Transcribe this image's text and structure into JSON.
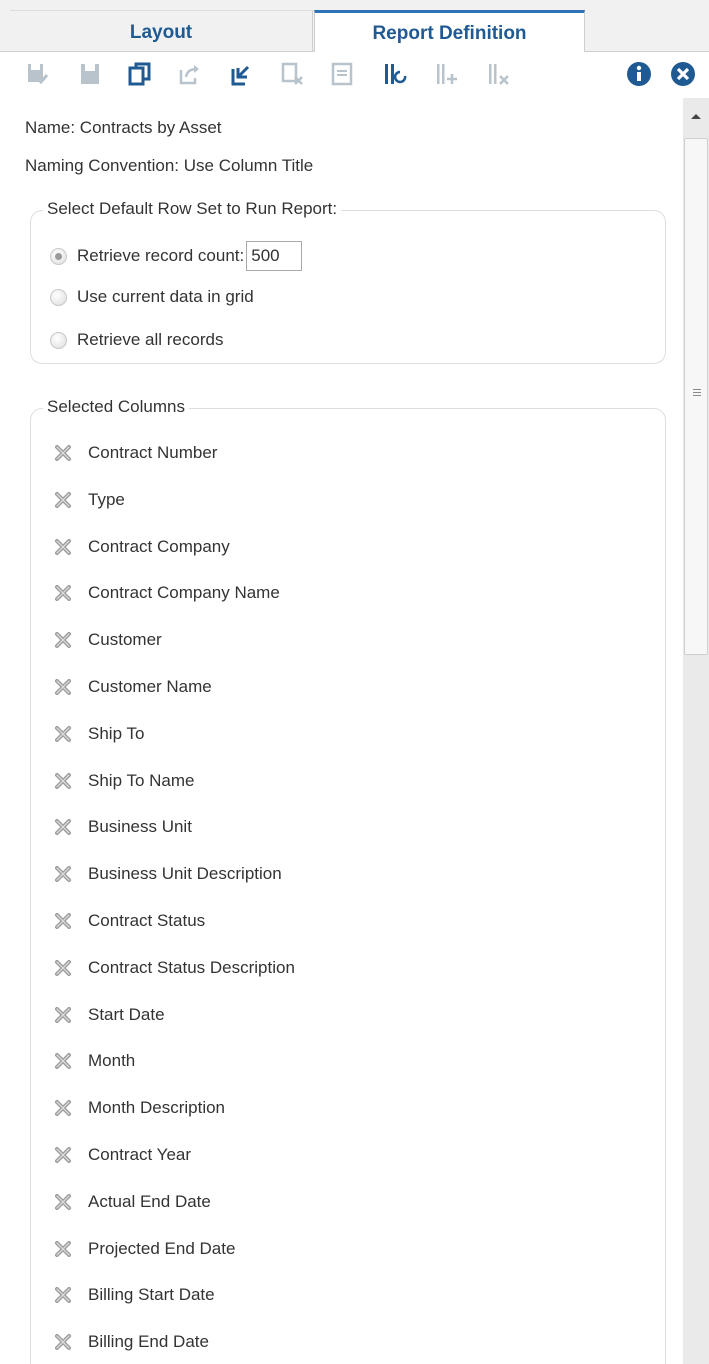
{
  "tabs": [
    {
      "label": "Layout",
      "active": false
    },
    {
      "label": "Report Definition",
      "active": true
    }
  ],
  "toolbar": {
    "icons": [
      "save-check-icon",
      "save-icon",
      "copy-icon",
      "share-icon",
      "export-icon",
      "delete-icon",
      "page-icon",
      "column-refresh-icon",
      "column-add-icon",
      "column-remove-icon",
      "info-icon",
      "close-icon"
    ],
    "accent_color": "#1f5a93",
    "disabled_color": "#b8c3cc"
  },
  "report": {
    "name_line": "Name: Contracts by Asset",
    "naming_line": "Naming Convention: Use Column Title"
  },
  "row_set": {
    "legend": "Select Default Row Set to Run Report:",
    "retrieve_count_label": "Retrieve record count:",
    "retrieve_count_value": "500",
    "current_data_label": "Use current data in grid",
    "all_records_label": "Retrieve all records",
    "selected_option": "retrieve_count"
  },
  "columns": {
    "legend": "Selected Columns",
    "items": [
      "Contract Number",
      "Type",
      "Contract Company",
      "Contract Company Name",
      "Customer",
      "Customer Name",
      "Ship To",
      "Ship To Name",
      "Business Unit",
      "Business Unit Description",
      "Contract Status",
      "Contract Status Description",
      "Start Date",
      "Month",
      "Month Description",
      "Contract Year",
      "Actual End Date",
      "Projected End Date",
      "Billing Start Date",
      "Billing End Date"
    ]
  }
}
